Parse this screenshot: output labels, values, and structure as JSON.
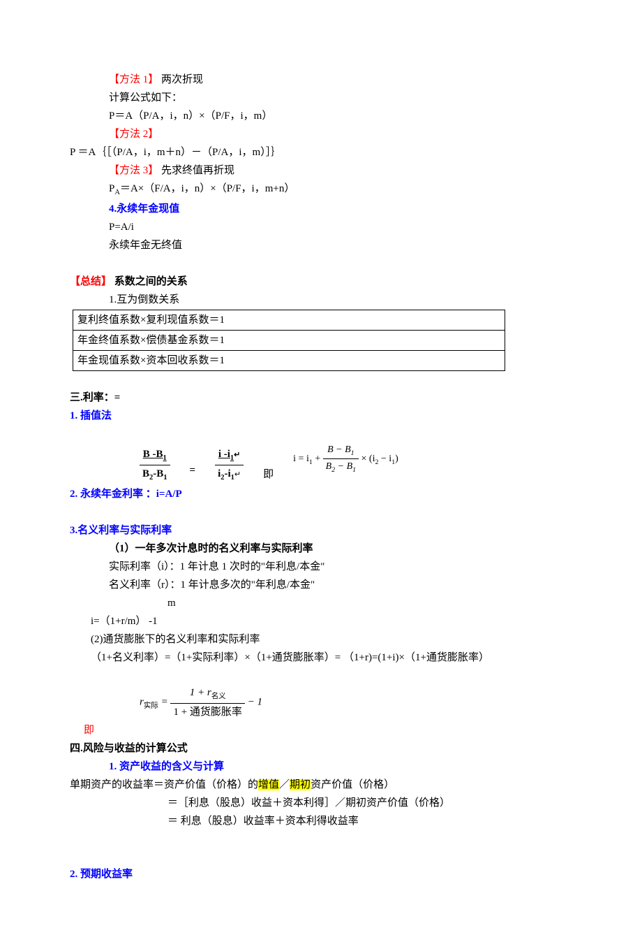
{
  "m1": {
    "tag": "【方法 1】",
    "title": "两次折现",
    "l1": "计算公式如下：",
    "l2": "P＝A（P/A，i，n）×（P/F，i，m）"
  },
  "m2": {
    "tag": "【方法 2】",
    "l1": "P ＝A｛［（P/A，i，m＋n）－（P/A，i，m）］｝"
  },
  "m3": {
    "tag": "【方法 3】",
    "title": "先求终值再折现",
    "l1": "＝A×（F/A，i，n）×（P/F，i，m+n）"
  },
  "s4": {
    "title": "4.永续年金现值",
    "l1": "P=A/i",
    "l2": "永续年金无终值"
  },
  "summary": {
    "tag": "【总结】",
    "title": "系数之间的关系",
    "l1": "1.互为倒数关系",
    "r1": "复利终值系数×复利现值系数＝1",
    "r2": "年金终值系数×偿债基金系数＝1",
    "r3": "年金现值系数×资本回收系数＝1"
  },
  "s3h": "三.利率：=",
  "interp": {
    "title": "1. 插值法",
    "num1": "B  -B",
    "den1_b": "B",
    "den1_b2": "-B",
    "num2": "i -i",
    "den2_a": "i",
    "den2_b": "-i",
    "eq": "=",
    "ji": "即",
    "rhs": "i = i₁ + (B − B₁)/(B₂ − B₁) × (i₂ − i₁)"
  },
  "perp": "2. 永续年金利率 ：i=A/P",
  "nom": {
    "title": "3.名义利率与实际利率",
    "l1": "（1）一年多次计息时的名义利率与实际利率",
    "l2": "实际利率（i）：1 年计息 1 次时的\"年利息/本金\"",
    "l3": "名义利率（r）：1 年计息多次的\"年利息/本金\"",
    "m": "m",
    "f": "i=（1+r/m）  -1",
    "l4": "(2)通货膨胀下的名义利率和实际利率",
    "l5": "（1+名义利率）=（1+实际利率）×（1+通货膨胀率）= （1+r)=(1+i)×（1+通货膨胀率）",
    "ji": "即",
    "img_num": "1 + r",
    "img_num_sub": "名义",
    "img_den": "1 + 通货膨胀率",
    "img_lhs": "r",
    "img_lhs_sub": "实际",
    "img_tail": " − 1"
  },
  "s4h": "四.风险与收益的计算公式",
  "ret": {
    "title": "1. 资产收益的含义与计算",
    "l1a": "单期资产的收益率＝资产价值（价格）的",
    "l1b": "增值",
    "l1c": "／",
    "l1d": "期初",
    "l1e": "资产价值（价格）",
    "l2": "＝［利息（股息）收益＋资本利得］／期初资产价值（价格）",
    "l3": "＝ 利息（股息）收益率＋资本利得收益率"
  },
  "exp": "2. 预期收益率",
  "sub1": "1",
  "sub2": "2",
  "subA": "A"
}
